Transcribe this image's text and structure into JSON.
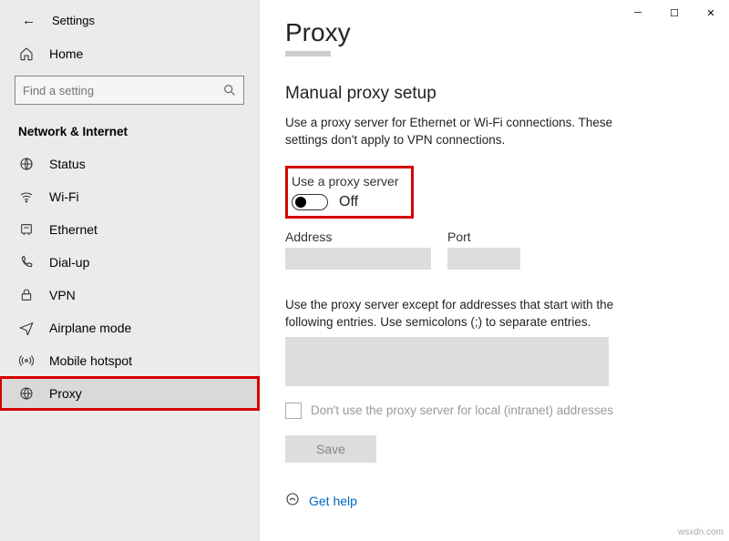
{
  "window": {
    "title": "Settings"
  },
  "sidebar": {
    "home": "Home",
    "search_placeholder": "Find a setting",
    "group": "Network & Internet",
    "items": [
      {
        "label": "Status"
      },
      {
        "label": "Wi-Fi"
      },
      {
        "label": "Ethernet"
      },
      {
        "label": "Dial-up"
      },
      {
        "label": "VPN"
      },
      {
        "label": "Airplane mode"
      },
      {
        "label": "Mobile hotspot"
      },
      {
        "label": "Proxy"
      }
    ]
  },
  "main": {
    "title": "Proxy",
    "section": "Manual proxy setup",
    "desc": "Use a proxy server for Ethernet or Wi-Fi connections. These settings don't apply to VPN connections.",
    "use_proxy_label": "Use a proxy server",
    "toggle_state": "Off",
    "address_label": "Address",
    "port_label": "Port",
    "except_desc": "Use the proxy server except for addresses that start with the following entries. Use semicolons (;) to separate entries.",
    "intranet_check": "Don't use the proxy server for local (intranet) addresses",
    "save": "Save",
    "help": "Get help"
  },
  "watermark": "wsxdn.com"
}
